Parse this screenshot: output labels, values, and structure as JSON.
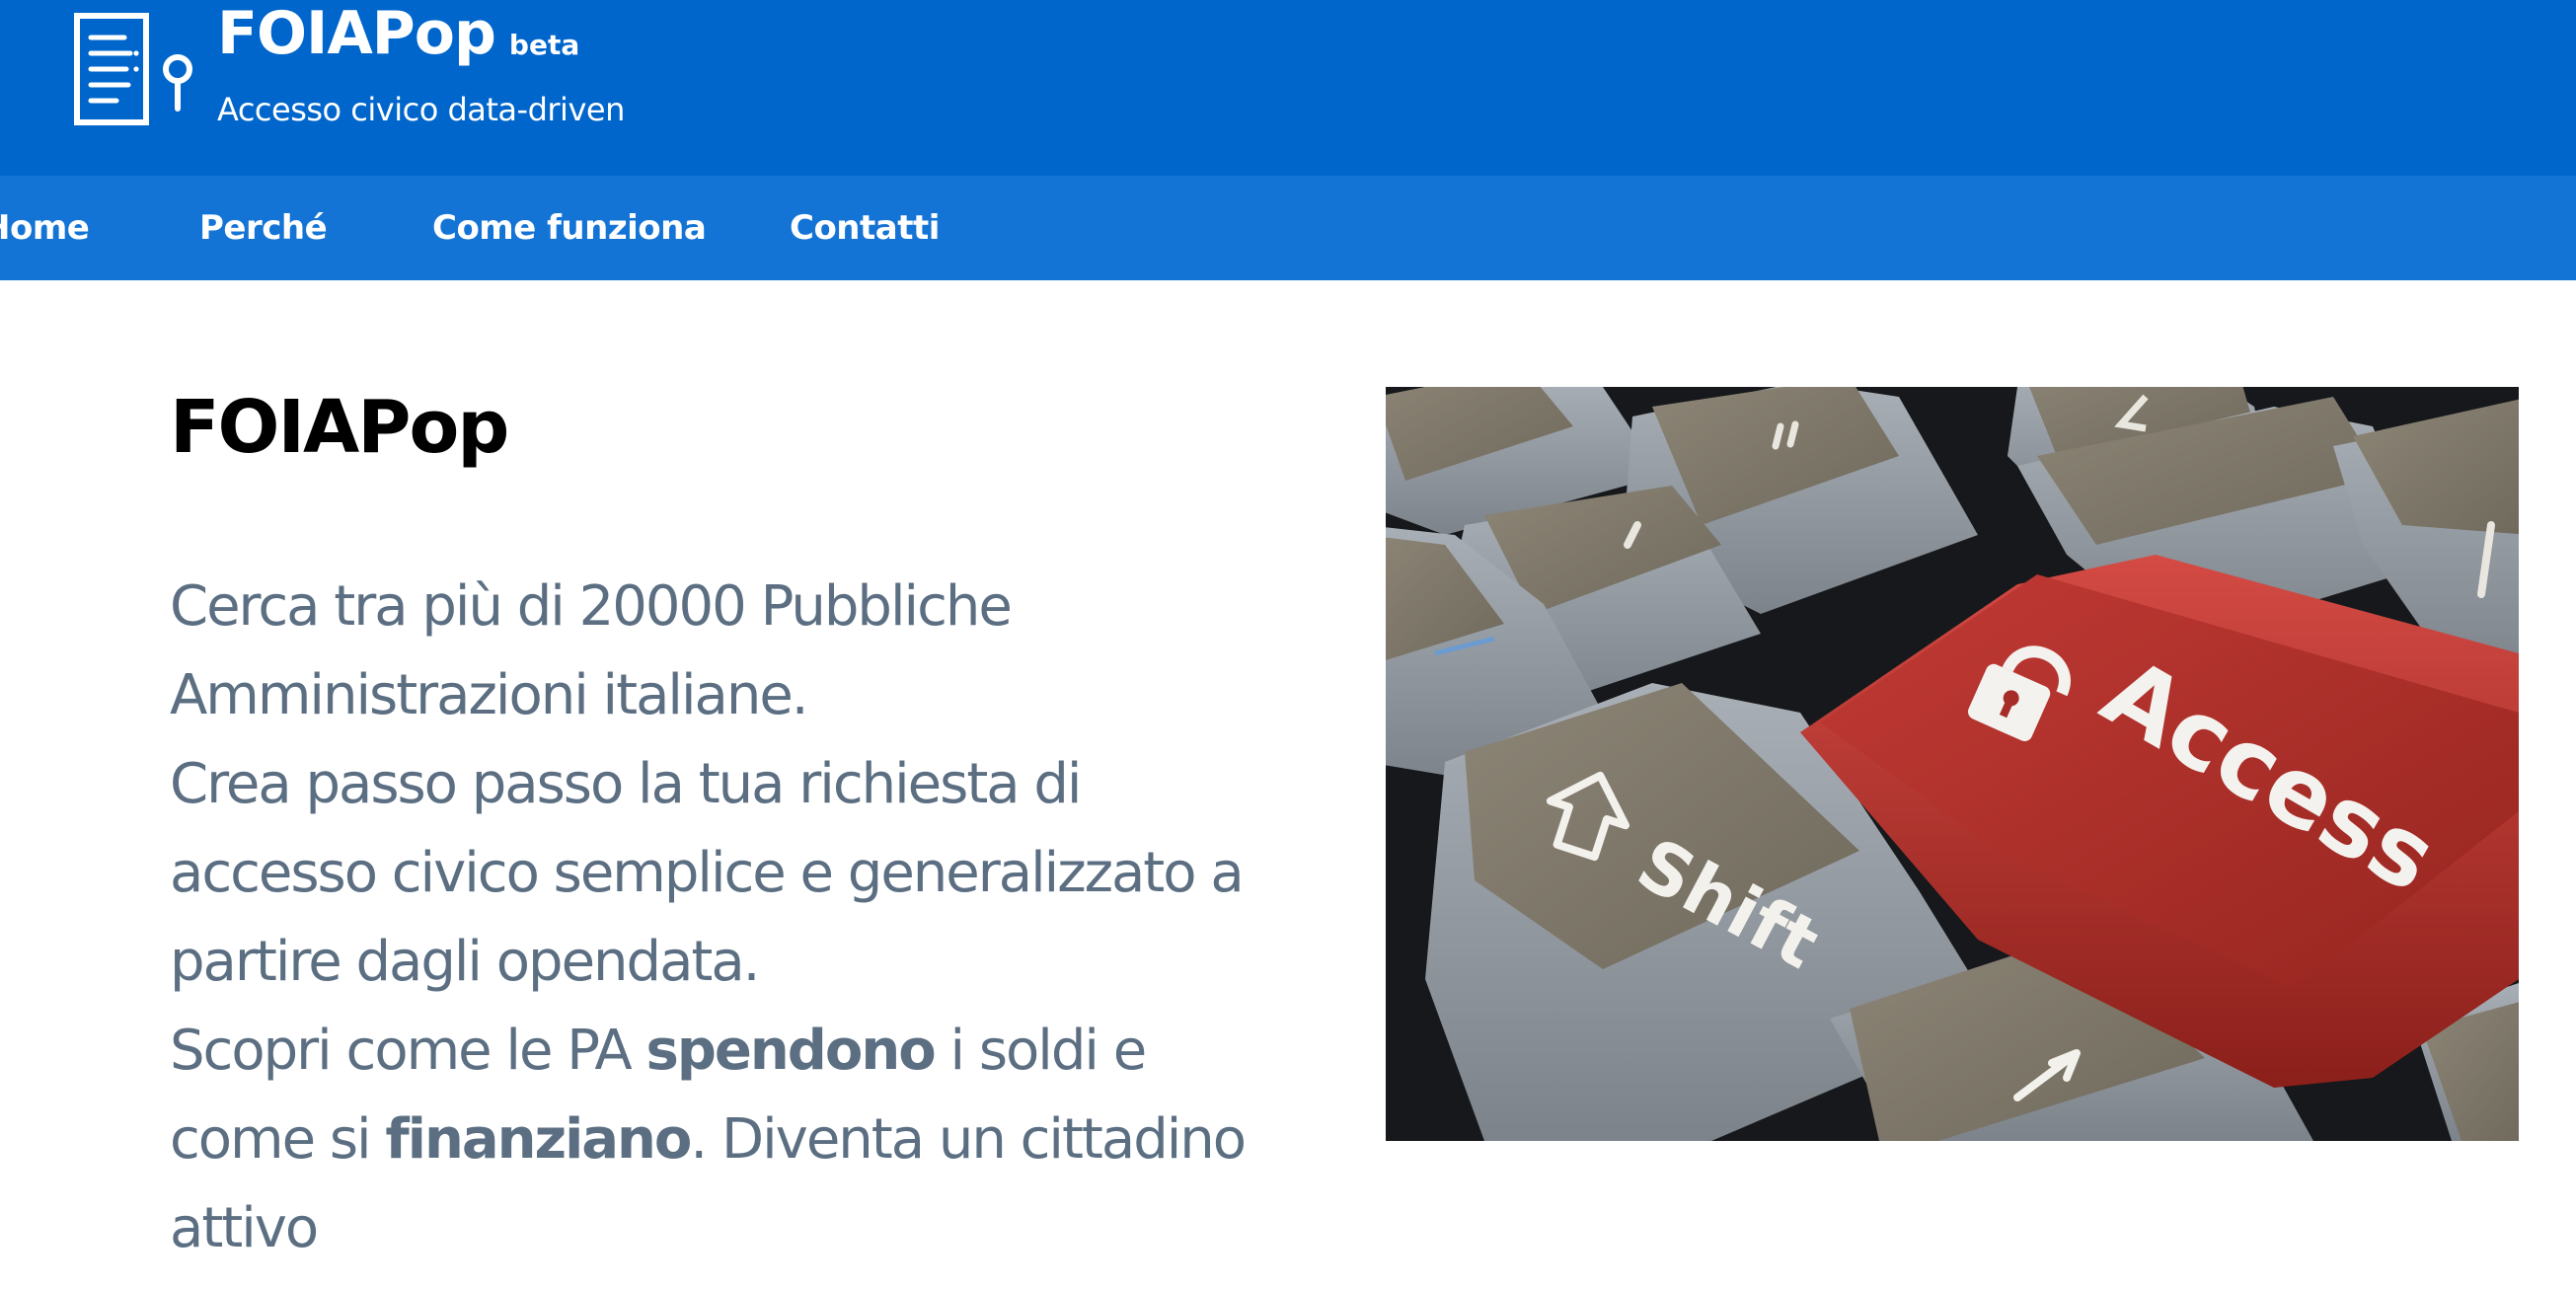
{
  "brand": {
    "name": "FOIAPop",
    "badge": "beta",
    "tagline": "Accesso civico data-driven"
  },
  "nav": {
    "items": [
      {
        "label": "Home"
      },
      {
        "label": "Perché"
      },
      {
        "label": "Come funziona"
      },
      {
        "label": "Contatti"
      }
    ]
  },
  "main": {
    "title": "FOIAPop",
    "paragraphs": {
      "p1": "Cerca tra più di 20000 Pubbliche Amministrazioni italiane.",
      "p2": "Crea passo passo la tua richiesta di accesso civico semplice e generalizzato a partire dagli opendata.",
      "p3_start": "Scopri come le PA ",
      "p3_bold1": "spendono",
      "p3_mid": " i soldi e come si ",
      "p3_bold2": "finanziano",
      "p3_end": ". Diventa un cittadino attivo"
    }
  },
  "hero": {
    "key_access_label": "Access",
    "key_shift_label": "Shift",
    "icons": [
      "padlock-icon",
      "shift-arrow-icon",
      "up-arrow-icon"
    ]
  },
  "colors": {
    "header_bg": "#0066cc",
    "nav_bg": "#1474d6",
    "text_muted": "#5c6f82",
    "access_key": "#b1312e"
  }
}
